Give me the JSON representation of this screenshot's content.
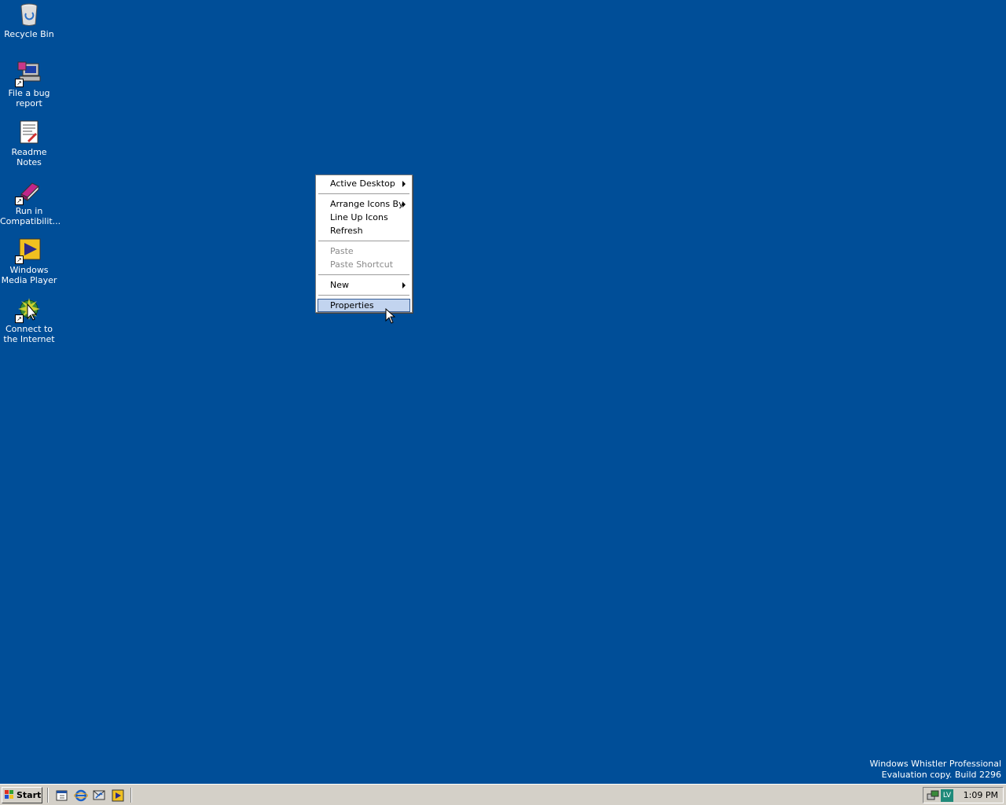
{
  "desktop_icons": [
    {
      "label": "Recycle Bin"
    },
    {
      "label": "File a bug report"
    },
    {
      "label": "Readme Notes"
    },
    {
      "label": "Run in Compatibilit..."
    },
    {
      "label": "Windows Media Player"
    },
    {
      "label": "Connect to the Internet"
    }
  ],
  "context_menu": {
    "items": [
      {
        "label": "Active Desktop",
        "submenu": true
      },
      {
        "label": "Arrange Icons By",
        "submenu": true
      },
      {
        "label": "Line Up Icons"
      },
      {
        "label": "Refresh"
      },
      {
        "label": "Paste",
        "disabled": true
      },
      {
        "label": "Paste Shortcut",
        "disabled": true
      },
      {
        "label": "New",
        "submenu": true
      },
      {
        "label": "Properties",
        "highlighted": true
      }
    ]
  },
  "watermark": {
    "line1": "Windows Whistler Professional",
    "line2": "Evaluation copy. Build 2296"
  },
  "taskbar": {
    "start_label": "Start",
    "quick_launch": [
      "show-desktop-icon",
      "internet-explorer-icon",
      "outlook-express-icon",
      "media-player-icon"
    ],
    "tray_icons": [
      "network-icon",
      "language-icon"
    ],
    "tray_language": "LV",
    "clock": "1:09 PM"
  },
  "colors": {
    "desktop": "#004e98",
    "menu_highlight": "#c2d4ef",
    "taskbar": "#d4d0c8"
  }
}
